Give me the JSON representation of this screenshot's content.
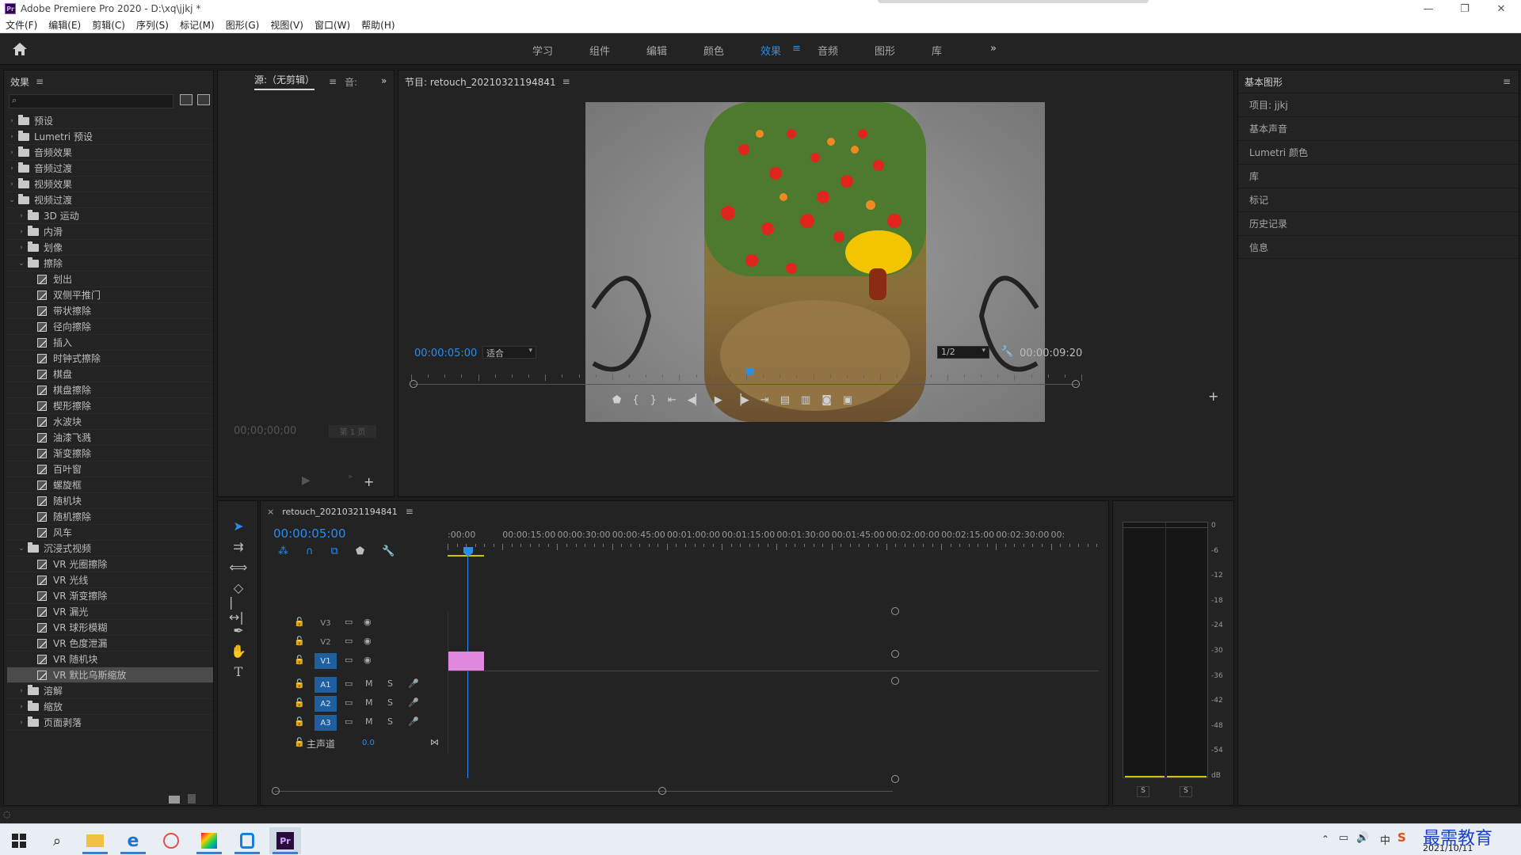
{
  "window": {
    "title": "Adobe Premiere Pro 2020 - D:\\xq\\jjkj *"
  },
  "menu": [
    "文件(F)",
    "编辑(E)",
    "剪辑(C)",
    "序列(S)",
    "标记(M)",
    "图形(G)",
    "视图(V)",
    "窗口(W)",
    "帮助(H)"
  ],
  "workspaces": {
    "items": [
      "学习",
      "组件",
      "编辑",
      "颜色",
      "效果",
      "音频",
      "图形",
      "库"
    ],
    "active": "效果"
  },
  "effects_panel": {
    "title": "效果",
    "tree": [
      {
        "label": "预设",
        "kind": "folder",
        "level": 0,
        "open": false
      },
      {
        "label": "Lumetri 预设",
        "kind": "folder",
        "level": 0,
        "open": false
      },
      {
        "label": "音频效果",
        "kind": "folder",
        "level": 0,
        "open": false
      },
      {
        "label": "音频过渡",
        "kind": "folder",
        "level": 0,
        "open": false
      },
      {
        "label": "视频效果",
        "kind": "folder",
        "level": 0,
        "open": false
      },
      {
        "label": "视频过渡",
        "kind": "folder",
        "level": 0,
        "open": true
      },
      {
        "label": "3D 运动",
        "kind": "folder",
        "level": 1,
        "open": false
      },
      {
        "label": "内滑",
        "kind": "folder",
        "level": 1,
        "open": false
      },
      {
        "label": "划像",
        "kind": "folder",
        "level": 1,
        "open": false
      },
      {
        "label": "擦除",
        "kind": "folder",
        "level": 1,
        "open": true
      },
      {
        "label": "划出",
        "kind": "fx",
        "level": 2
      },
      {
        "label": "双侧平推门",
        "kind": "fx",
        "level": 2
      },
      {
        "label": "带状擦除",
        "kind": "fx",
        "level": 2
      },
      {
        "label": "径向擦除",
        "kind": "fx",
        "level": 2
      },
      {
        "label": "插入",
        "kind": "fx",
        "level": 2
      },
      {
        "label": "时钟式擦除",
        "kind": "fx",
        "level": 2
      },
      {
        "label": "棋盘",
        "kind": "fx",
        "level": 2
      },
      {
        "label": "棋盘擦除",
        "kind": "fx",
        "level": 2
      },
      {
        "label": "楔形擦除",
        "kind": "fx",
        "level": 2
      },
      {
        "label": "水波块",
        "kind": "fx",
        "level": 2
      },
      {
        "label": "油漆飞溅",
        "kind": "fx",
        "level": 2
      },
      {
        "label": "渐变擦除",
        "kind": "fx",
        "level": 2
      },
      {
        "label": "百叶窗",
        "kind": "fx",
        "level": 2
      },
      {
        "label": "螺旋框",
        "kind": "fx",
        "level": 2
      },
      {
        "label": "随机块",
        "kind": "fx",
        "level": 2
      },
      {
        "label": "随机擦除",
        "kind": "fx",
        "level": 2
      },
      {
        "label": "风车",
        "kind": "fx",
        "level": 2
      },
      {
        "label": "沉浸式视频",
        "kind": "folder",
        "level": 1,
        "open": true
      },
      {
        "label": "VR 光圈擦除",
        "kind": "fx",
        "level": 2
      },
      {
        "label": "VR 光线",
        "kind": "fx",
        "level": 2
      },
      {
        "label": "VR 渐变擦除",
        "kind": "fx",
        "level": 2
      },
      {
        "label": "VR 漏光",
        "kind": "fx",
        "level": 2
      },
      {
        "label": "VR 球形模糊",
        "kind": "fx",
        "level": 2
      },
      {
        "label": "VR 色度泄漏",
        "kind": "fx",
        "level": 2
      },
      {
        "label": "VR 随机块",
        "kind": "fx",
        "level": 2
      },
      {
        "label": "VR 默比乌斯缩放",
        "kind": "fx",
        "level": 2,
        "selected": true
      },
      {
        "label": "溶解",
        "kind": "folder",
        "level": 1,
        "open": false
      },
      {
        "label": "缩放",
        "kind": "folder",
        "level": 1,
        "open": false
      },
      {
        "label": "页面剥落",
        "kind": "folder",
        "level": 1,
        "open": false
      }
    ]
  },
  "source_panel": {
    "tab": "源:（无剪辑）",
    "tab2": "音:",
    "timecode": "00;00;00;00",
    "page": "第 1 页"
  },
  "program_panel": {
    "title": "节目: retouch_20210321194841",
    "timecode": "00:00:05:00",
    "fit": "适合",
    "resolution": "1/2",
    "duration": "00:00:09:20",
    "playhead_position": 0.505
  },
  "right_panel": {
    "title": "基本图形",
    "items": [
      "项目: jjkj",
      "基本声音",
      "Lumetri 颜色",
      "库",
      "标记",
      "历史记录",
      "信息"
    ]
  },
  "timeline": {
    "sequence": "retouch_20210321194841",
    "timecode": "00:00:05:00",
    "ruler": [
      ":00:00",
      "00:00:15:00",
      "00:00:30:00",
      "00:00:45:00",
      "00:01:00:00",
      "00:01:15:00",
      "00:01:30:00",
      "00:01:45:00",
      "00:02:00:00",
      "00:02:15:00",
      "00:02:30:00",
      "00:"
    ],
    "video_tracks": [
      "V3",
      "V2",
      "V1"
    ],
    "audio_tracks": [
      "A1",
      "A2",
      "A3"
    ],
    "audio_labels": {
      "mute": "M",
      "solo": "S"
    },
    "master": {
      "label": "主声道",
      "value": "0.0"
    }
  },
  "meter": {
    "scale": [
      "0",
      "-6",
      "-12",
      "-18",
      "-24",
      "-30",
      "-36",
      "-42",
      "-48",
      "-54",
      "dB"
    ],
    "solo": [
      "S",
      "S"
    ]
  },
  "taskbar": {
    "date": "2021/10/11",
    "watermark": "最需教育",
    "ime": "中"
  },
  "colors": {
    "accent": "#2d8ceb",
    "clip": "#e087e0",
    "track_on": "#1f5f9e"
  }
}
